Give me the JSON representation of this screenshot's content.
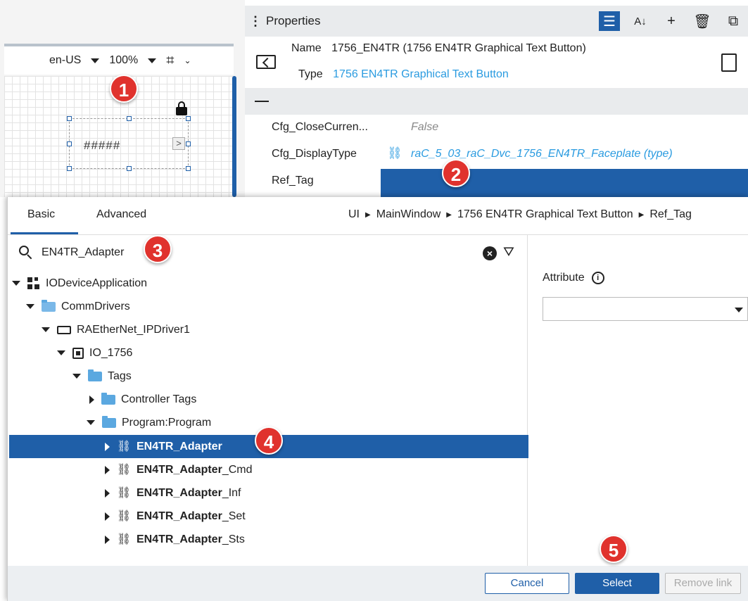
{
  "canvas": {
    "language": "en-US",
    "zoom": "100%",
    "widget_text": "#####"
  },
  "properties": {
    "title": "Properties",
    "name_label": "Name",
    "name_value": "1756_EN4TR (1756 EN4TR Graphical Text Button)",
    "type_label": "Type",
    "type_value": "1756 EN4TR Graphical Text Button",
    "rows": [
      {
        "label": "Cfg_CloseCurren...",
        "value": "False"
      },
      {
        "label": "Cfg_DisplayType",
        "value": "raC_5_03_raC_Dvc_1756_EN4TR_Faceplate (type)"
      },
      {
        "label": "Ref_Tag",
        "value": ""
      }
    ]
  },
  "dialog": {
    "tabs": [
      "Basic",
      "Advanced"
    ],
    "breadcrumb": [
      "UI",
      "MainWindow",
      "1756 EN4TR Graphical Text Button",
      "Ref_Tag"
    ],
    "search_value": "EN4TR_Adapter",
    "tree": [
      {
        "label": "IODeviceApplication"
      },
      {
        "label": "CommDrivers"
      },
      {
        "label": "RAEtherNet_IPDriver1"
      },
      {
        "label": "IO_1756"
      },
      {
        "label": "Tags"
      },
      {
        "label": "Controller Tags"
      },
      {
        "label": "Program:Program"
      },
      {
        "bold": "EN4TR_Adapter",
        "rest": ""
      },
      {
        "bold": "EN4TR_Adapter",
        "rest": "_Cmd"
      },
      {
        "bold": "EN4TR_Adapter",
        "rest": "_Inf"
      },
      {
        "bold": "EN4TR_Adapter",
        "rest": "_Set"
      },
      {
        "bold": "EN4TR_Adapter",
        "rest": "_Sts"
      }
    ],
    "attribute_label": "Attribute",
    "buttons": {
      "cancel": "Cancel",
      "select": "Select",
      "remove": "Remove link"
    }
  },
  "steps": [
    "1",
    "2",
    "3",
    "4",
    "5"
  ],
  "colors": {
    "accent": "#1f5fa8",
    "link": "#2a9be0",
    "step_badge": "#e0322d"
  }
}
